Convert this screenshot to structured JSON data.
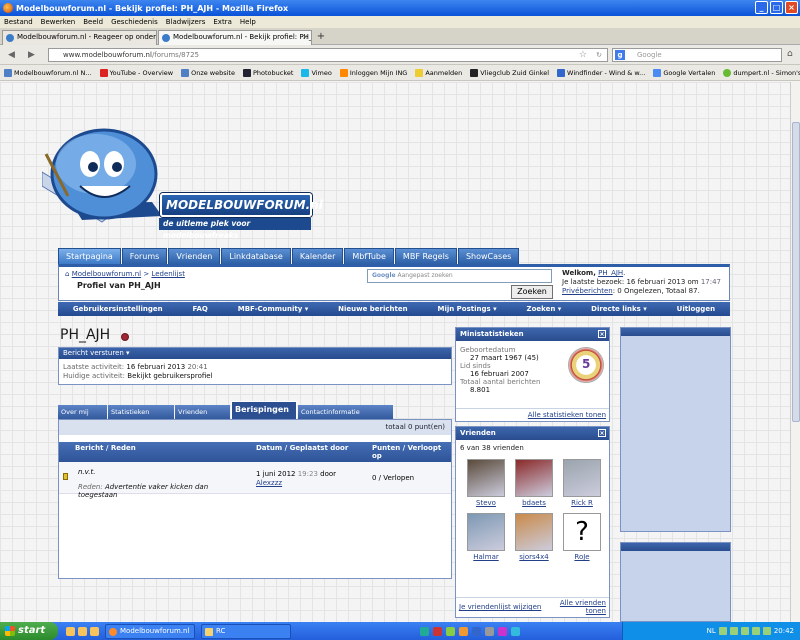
{
  "window": {
    "title": "Modelbouwforum.nl - Bekijk profiel: PH_AJH - Mozilla Firefox"
  },
  "menu": [
    "Bestand",
    "Bewerken",
    "Beeld",
    "Geschiedenis",
    "Bladwijzers",
    "Extra",
    "Help"
  ],
  "tabs": [
    {
      "label": "Modelbouwforum.nl - Reageer op onder..."
    },
    {
      "label": "Modelbouwforum.nl - Bekijk profiel: PH_A..."
    }
  ],
  "nav": {
    "url_host": "www.modelbouwforum.nl",
    "url_path": "/forums/8725",
    "search_placeholder": "Google"
  },
  "bookmarks": [
    "Modelbouwforum.nl N...",
    "YouTube - Overview",
    "Onze website",
    "Photobucket",
    "Vimeo",
    "Inloggen Mijn ING",
    "Aanmelden",
    "Vliegclub Zuid Ginkel",
    "Windfinder - Wind & w...",
    "Google Vertalen",
    "dumpert.nl - Simon's C..."
  ],
  "logo": {
    "name": "MODELBOUWFORUM.nl",
    "tagline": "de uitleme plek voor modelbouwfreaks"
  },
  "site_tabs": [
    "Startpagina",
    "Forums",
    "Vrienden",
    "Linkdatabase",
    "Kalender",
    "MbfTube",
    "MBF Regels",
    "ShowCases"
  ],
  "breadcrumb": {
    "home": "Modelbouwforum.nl",
    "sep": ">",
    "list": "Ledenlijst",
    "current": "Profiel van PH_AJH"
  },
  "site_search": {
    "prefix": "Google",
    "placeholder": "Aangepast zoeken",
    "button": "Zoeken"
  },
  "welcome": {
    "label": "Welkom,",
    "user": "PH_AJH",
    "suffix": ".",
    "last_visit_label": "Je laatste bezoek:",
    "last_visit_date": "16 februari 2013 om",
    "last_visit_time": "17:47",
    "pm_link": "Privéberichten",
    "pm_text": ": 0 Ongelezen, Totaal 87."
  },
  "subnav": [
    "Gebruikersinstellingen",
    "FAQ",
    "MBF-Community ▾",
    "Nieuwe berichten",
    "Mijn Postings ▾",
    "Zoeken ▾",
    "Directe links ▾",
    "Uitloggen"
  ],
  "profile": {
    "name": "PH_AJH",
    "send_message": "Bericht versturen",
    "last_activity_label": "Laatste activiteit:",
    "last_activity_date": "16 februari 2013",
    "last_activity_time": "20:41",
    "current_activity_label": "Huidige activiteit:",
    "current_activity": "Bekijkt gebruikersprofiel"
  },
  "profile_tabs": [
    "Over mij",
    "Statistieken",
    "Vrienden",
    "Berispingen",
    "Contactinformatie"
  ],
  "warnings": {
    "total": "totaal 0 punt(en)",
    "headers": [
      "Bericht / Reden",
      "Datum / Geplaatst door",
      "Punten / Verloopt op"
    ],
    "rows": [
      {
        "title": "n.v.t.",
        "reason_label": "Reden:",
        "reason": "Advertentie vaker kicken dan toegestaan",
        "date": "1 juni 2012",
        "time": "19:23",
        "by": "door",
        "poster": "Alexzzz",
        "points": "0 / Verlopen"
      }
    ]
  },
  "ministats": {
    "title": "Ministatistieken",
    "birth_label": "Geboortedatum",
    "birth": "27 maart 1967 (45)",
    "member_label": "Lid sinds",
    "member": "16 februari 2007",
    "posts_label": "Totaal aantal berichten",
    "posts": "8.801",
    "link": "Alle statistieken tonen",
    "badge": "5"
  },
  "friends": {
    "title": "Vrienden",
    "count": "6 van 38 vrienden",
    "list": [
      {
        "name": "Stevo",
        "color": "#5a4a3a"
      },
      {
        "name": "bdaets",
        "color": "#8a2a2a"
      },
      {
        "name": "Rick R",
        "color": "#9aa4ad"
      },
      {
        "name": "Halmar",
        "color": "#7d98b3"
      },
      {
        "name": "sjors4x4",
        "color": "#c98a4a"
      },
      {
        "name": "RoJe",
        "color": "#f4f4f4"
      }
    ],
    "list_link": "Je vriendenlijst wijzigen",
    "all_link": "Alle vrienden tonen"
  },
  "taskbar": {
    "start": "start",
    "items": [
      "Modelbouwforum.nl - ...",
      "RC"
    ],
    "lang": "NL",
    "clock": "20:42"
  }
}
